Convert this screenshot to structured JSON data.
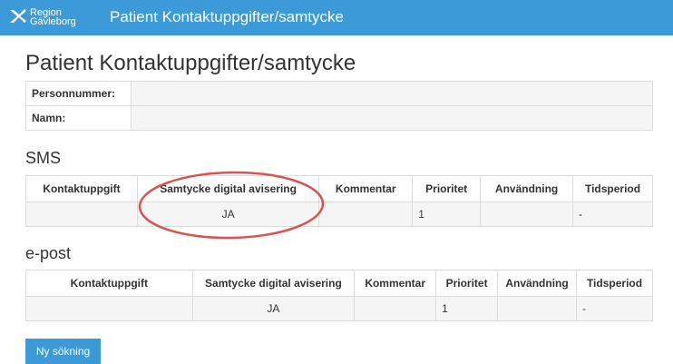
{
  "header": {
    "logo_line1": "Region",
    "logo_line2": "Gävleborg",
    "title": "Patient Kontaktuppgifter/samtycke"
  },
  "page_title": "Patient Kontaktuppgifter/samtycke",
  "patient": {
    "personnummer_label": "Personnummer:",
    "personnummer_value": "",
    "namn_label": "Namn:",
    "namn_value": ""
  },
  "sms": {
    "title": "SMS",
    "columns": [
      "Kontaktuppgift",
      "Samtycke digital avisering",
      "Kommentar",
      "Prioritet",
      "Användning",
      "Tidsperiod"
    ],
    "rows": [
      {
        "kontakt": "",
        "samtycke": "JA",
        "kommentar": "",
        "prioritet": "1",
        "anvandning": "",
        "tidsperiod": "-"
      }
    ]
  },
  "epost": {
    "title": "e-post",
    "columns": [
      "Kontaktuppgift",
      "Samtycke digital avisering",
      "Kommentar",
      "Prioritet",
      "Användning",
      "Tidsperiod"
    ],
    "rows": [
      {
        "kontakt": "",
        "samtycke": "JA",
        "kommentar": "",
        "prioritet": "1",
        "anvandning": "",
        "tidsperiod": "-"
      }
    ]
  },
  "new_search_button": "Ny sökning",
  "colors": {
    "header_bg": "#3d9ad8",
    "button_bg": "#3d9ad8",
    "annotation_circle": "#d9534f"
  }
}
